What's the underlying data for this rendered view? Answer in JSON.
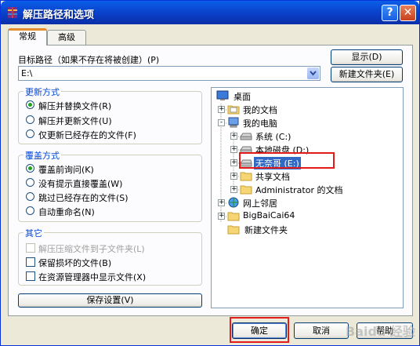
{
  "window": {
    "title": "解压路径和选项",
    "help_btn": "?",
    "close_btn": "✕"
  },
  "tabs": [
    {
      "label": "常规",
      "active": true
    },
    {
      "label": "高级",
      "active": false
    }
  ],
  "target": {
    "label": "目标路径（如果不存在将被创建）(P)",
    "value": "E:\\",
    "show_button": "显示(D)",
    "new_folder_button": "新建文件夹(E)"
  },
  "update_group": {
    "title": "更新方式",
    "options": [
      {
        "label": "解压并替换文件(R)",
        "selected": true
      },
      {
        "label": "解压并更新文件(U)",
        "selected": false
      },
      {
        "label": "仅更新已经存在的文件(F)",
        "selected": false
      }
    ]
  },
  "overwrite_group": {
    "title": "覆盖方式",
    "options": [
      {
        "label": "覆盖前询问(K)",
        "selected": true
      },
      {
        "label": "没有提示直接覆盖(W)",
        "selected": false
      },
      {
        "label": "跳过已经存在的文件(S)",
        "selected": false
      },
      {
        "label": "自动重命名(N)",
        "selected": false
      }
    ]
  },
  "other_group": {
    "title": "其它",
    "options": [
      {
        "label": "解压压缩文件到子文件夹(L)",
        "checked": false,
        "disabled": true
      },
      {
        "label": "保留损坏的文件(B)",
        "checked": false,
        "disabled": false
      },
      {
        "label": "在资源管理器中显示文件(X)",
        "checked": false,
        "disabled": false
      }
    ]
  },
  "save_button": "保存设置(V)",
  "tree": {
    "nodes": [
      {
        "label": "桌面",
        "icon": "desktop-icon"
      },
      {
        "label": "我的文档",
        "icon": "folder-icon",
        "expander": "+"
      },
      {
        "label": "我的电脑",
        "icon": "computer-icon",
        "expander": "-"
      },
      {
        "label": "系统 (C:)",
        "icon": "drive-icon",
        "expander": "+"
      },
      {
        "label": "本地磁盘 (D:)",
        "icon": "drive-icon",
        "expander": "+"
      },
      {
        "label": "无奈哥 (E:)",
        "icon": "drive-icon",
        "expander": "+",
        "selected": true
      },
      {
        "label": "共享文档",
        "icon": "folder-icon",
        "expander": "+"
      },
      {
        "label": "Administrator 的文档",
        "icon": "folder-icon",
        "expander": "+"
      },
      {
        "label": "网上邻居",
        "icon": "network-icon",
        "expander": "+"
      },
      {
        "label": "BigBaiCai64",
        "icon": "folder-icon",
        "expander": "+"
      },
      {
        "label": "新建文件夹",
        "icon": "folder-icon"
      }
    ]
  },
  "footer": {
    "ok": "确定",
    "cancel": "取消",
    "help": "帮助"
  },
  "watermark": "Baidu 经验",
  "colors": {
    "title_bar": "#0a4fd8",
    "group_title": "#0046d5",
    "selection": "#316ac5",
    "highlight_box": "#e31b1b"
  }
}
